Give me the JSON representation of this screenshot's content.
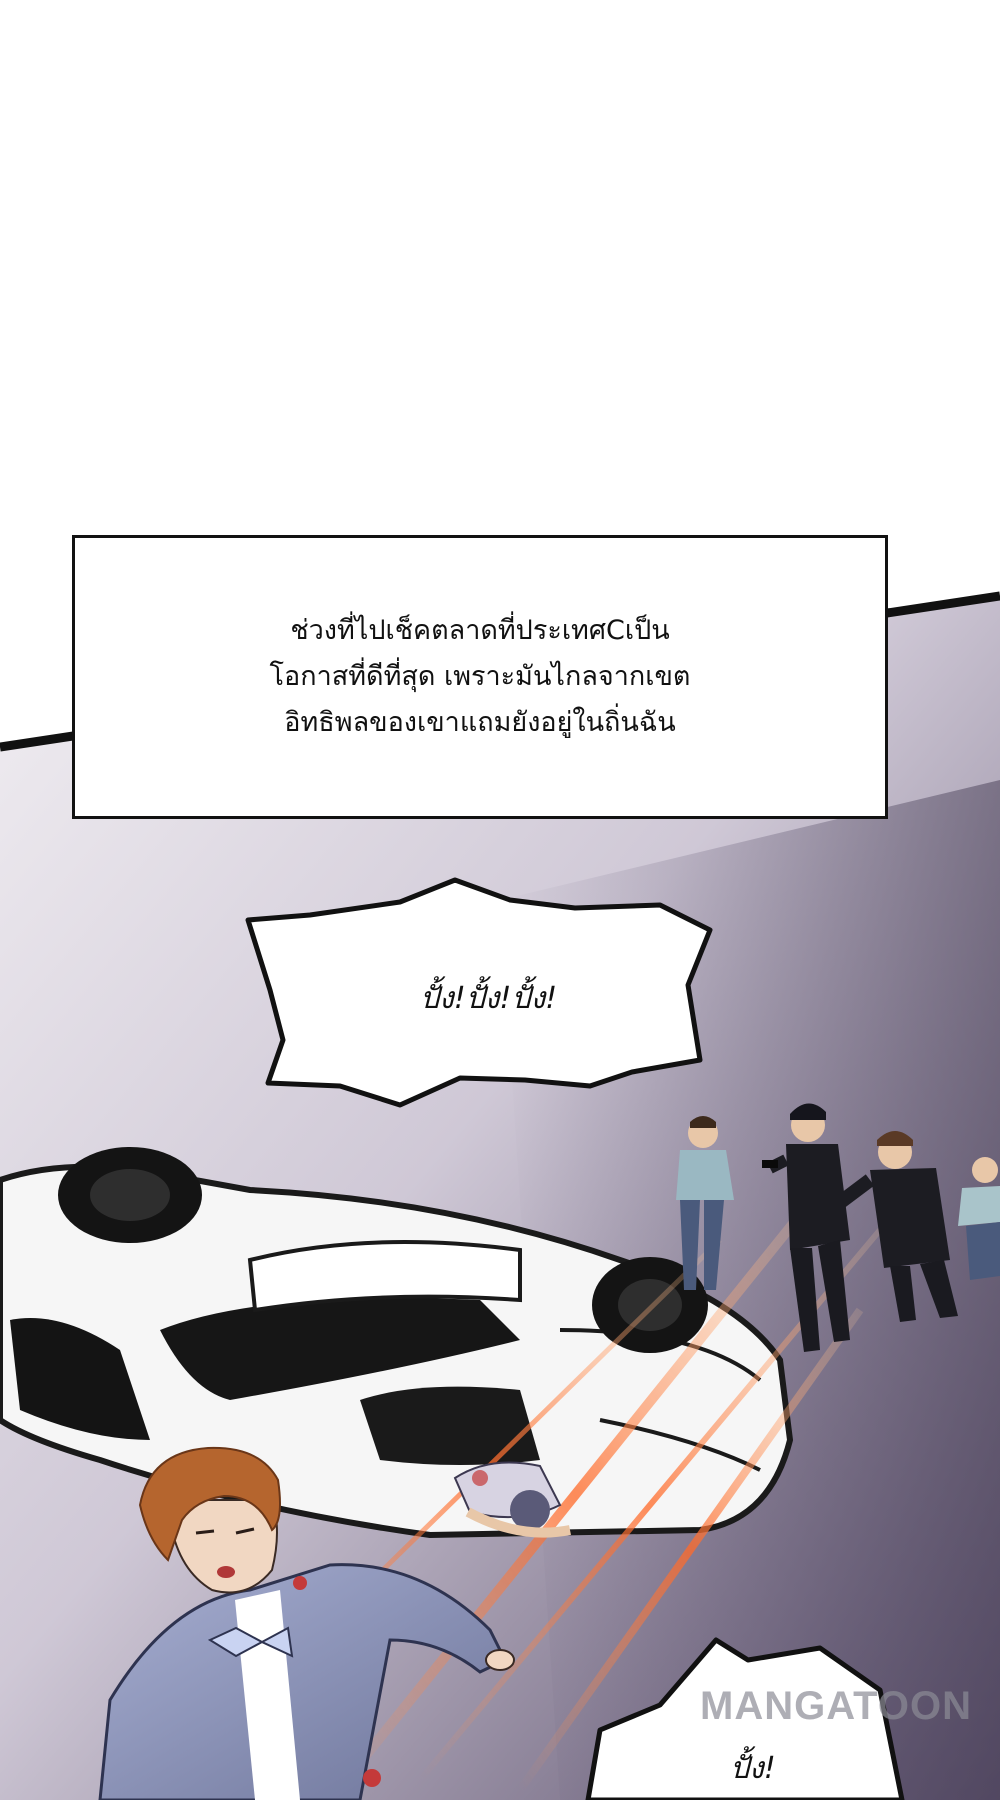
{
  "narration": {
    "lines": [
      "ช่วงที่ไปเช็คตลาดที่ประเทศCเป็น",
      "โอกาสที่ดีที่สุด เพราะมันไกลจากเขต",
      "อิทธิพลของเขาแถมยังอยู่ในถิ่นฉัน"
    ]
  },
  "bubbles": {
    "gunfire": "ปั้ง!ปั้ง!ปั้ง!",
    "gunshot_bottom": "ปั้ง!"
  },
  "watermark": "MANGATOON",
  "colors": {
    "background_top": "#ffffff",
    "ground_light": "#ece8ee",
    "ground_dark": "#4a4158",
    "panel_border": "#111111",
    "bullet_streak": "#ff7a3c",
    "car_body": "#f4f4f4",
    "suit_blue": "#8a92b8",
    "hair_brown": "#b5652e"
  }
}
